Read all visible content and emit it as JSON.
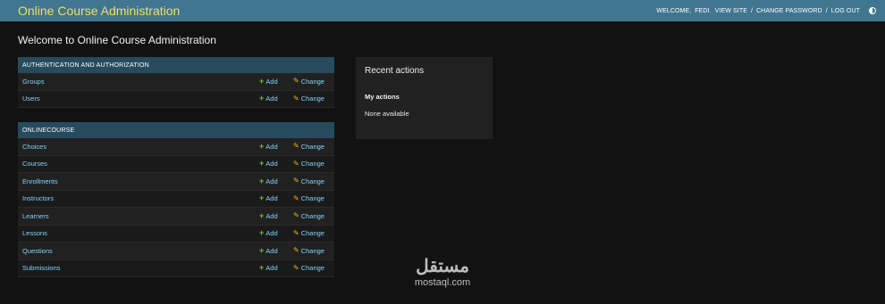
{
  "header": {
    "title": "Online Course Administration",
    "welcome": "WELCOME,",
    "username": "FEDI.",
    "view_site": "VIEW SITE",
    "change_password": "CHANGE PASSWORD",
    "log_out": "LOG OUT",
    "separator": "/"
  },
  "page": {
    "title": "Welcome to Online Course Administration"
  },
  "modules": [
    {
      "caption": "Authentication and Authorization",
      "rows": [
        {
          "name": "Groups",
          "add": "Add",
          "change": "Change"
        },
        {
          "name": "Users",
          "add": "Add",
          "change": "Change"
        }
      ]
    },
    {
      "caption": "Onlinecourse",
      "rows": [
        {
          "name": "Choices",
          "add": "Add",
          "change": "Change"
        },
        {
          "name": "Courses",
          "add": "Add",
          "change": "Change"
        },
        {
          "name": "Enrollments",
          "add": "Add",
          "change": "Change"
        },
        {
          "name": "Instructors",
          "add": "Add",
          "change": "Change"
        },
        {
          "name": "Learners",
          "add": "Add",
          "change": "Change"
        },
        {
          "name": "Lessons",
          "add": "Add",
          "change": "Change"
        },
        {
          "name": "Questions",
          "add": "Add",
          "change": "Change"
        },
        {
          "name": "Submissions",
          "add": "Add",
          "change": "Change"
        }
      ]
    }
  ],
  "recent_actions": {
    "title": "Recent actions",
    "my_actions": "My actions",
    "none": "None available"
  },
  "watermark": {
    "logo": "مستقل",
    "text": "mostaql.com"
  },
  "icons": {
    "add": "plus-icon",
    "change": "pencil-icon",
    "theme": "theme-toggle-icon"
  },
  "colors": {
    "header_bg": "#417690",
    "branding": "#f5dd5d",
    "caption_bg": "#264b5d",
    "link": "#81d4fa",
    "add_icon": "#70bf2b",
    "change_icon": "#efb80b"
  }
}
